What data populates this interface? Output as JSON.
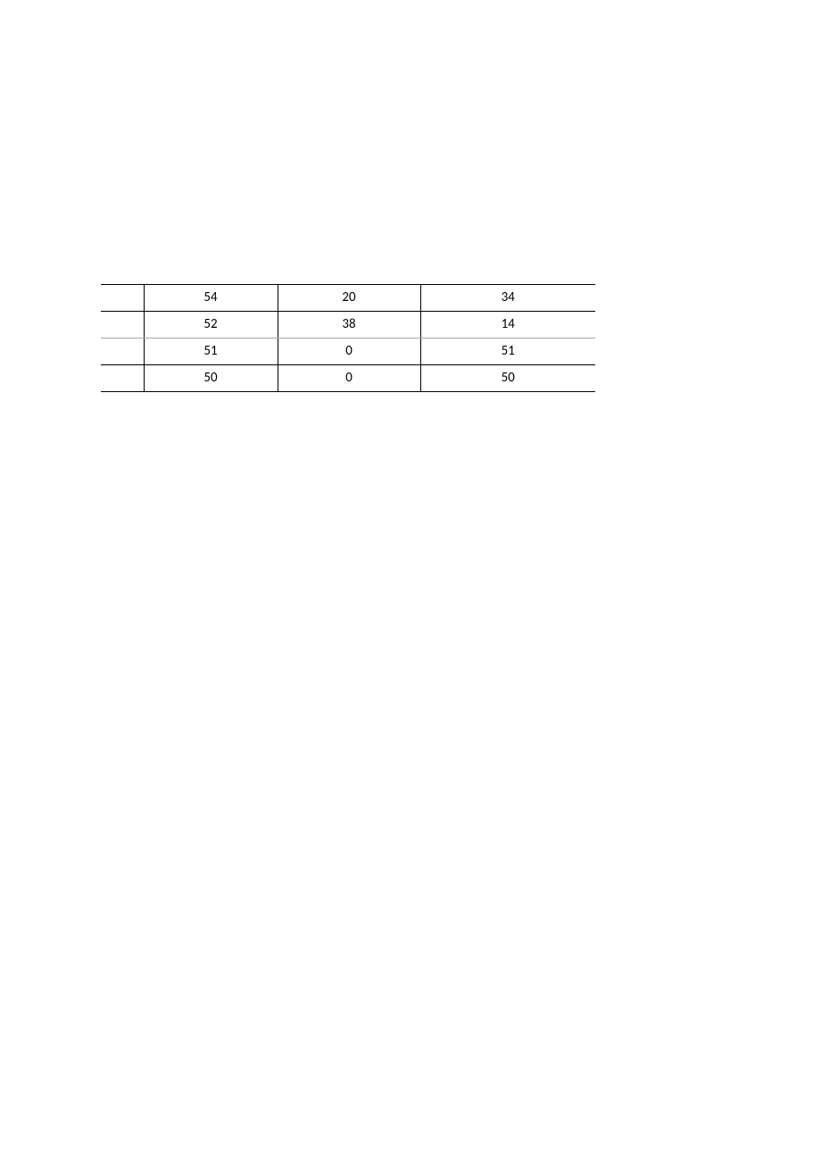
{
  "chart_data": {
    "type": "table",
    "rows": [
      {
        "c0": "",
        "c1": "54",
        "c2": "20",
        "c3": "34"
      },
      {
        "c0": "",
        "c1": "52",
        "c2": "38",
        "c3": "14"
      },
      {
        "c0": "",
        "c1": "51",
        "c2": "0",
        "c3": "51"
      },
      {
        "c0": "",
        "c1": "50",
        "c2": "0",
        "c3": "50"
      }
    ]
  }
}
